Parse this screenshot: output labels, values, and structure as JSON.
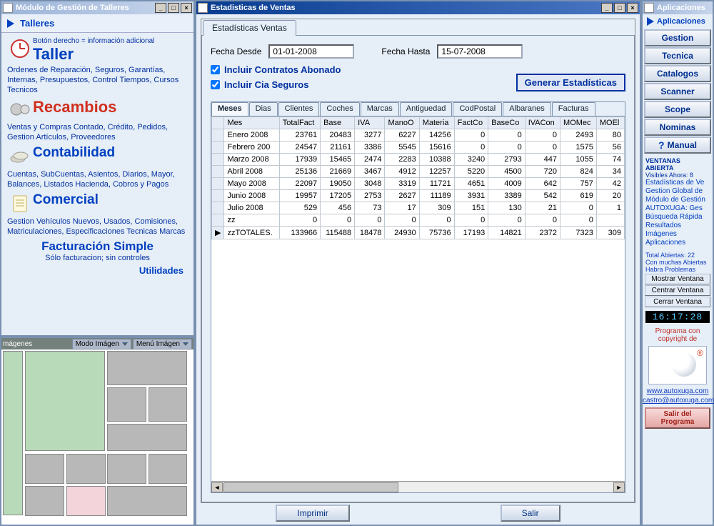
{
  "left": {
    "title": "Módulo de Gestión de Talleres",
    "header": "Talleres",
    "note": "Botón derecho = información adicional",
    "taller": {
      "title": "Taller",
      "desc": "Ordenes de Reparación, Seguros, Garantías, Internas, Presupuestos, Control Tiempos, Cursos Tecnicos"
    },
    "recambios": {
      "title": "Recambios",
      "desc": "Ventas y Compras Contado, Crédito, Pedidos, Gestion Artículos, Proveedores"
    },
    "contabilidad": {
      "title": "Contabilidad",
      "desc": "Cuentas, SubCuentas, Asientos, Diarios, Mayor, Balances, Listados Hacienda, Cobros y Pagos"
    },
    "comercial": {
      "title": "Comercial",
      "desc": "Gestion Vehículos Nuevos, Usados, Comisiones, Matriculaciones, Especificaciones Tecnicas Marcas"
    },
    "factsimple": {
      "title": "Facturación Simple",
      "desc": "Sólo facturacion; sin controles"
    },
    "utilidades": "Utilidades",
    "images": {
      "title": "mágenes",
      "modo": "Modo Imágen",
      "menu": "Menú Imágen"
    }
  },
  "mid": {
    "title": "Estadisticas de Ventas",
    "tab": "Estadísticas Ventas",
    "desde_label": "Fecha Desde",
    "desde_value": "01-01-2008",
    "hasta_label": "Fecha Hasta",
    "hasta_value": "15-07-2008",
    "chk1": "Incluir Contratos Abonado",
    "chk2": "Incluir Cia Seguros",
    "gen_btn": "Generar Estadísticas",
    "grid_tabs": [
      "Meses",
      "Dias",
      "Clientes",
      "Coches",
      "Marcas",
      "Antiguedad",
      "CodPostal",
      "Albaranes",
      "Facturas"
    ],
    "columns": [
      "Mes",
      "TotalFact",
      "Base",
      "IVA",
      "ManoO",
      "Materia",
      "FactCo",
      "BaseCo",
      "IVACon",
      "MOMec",
      "MOEl"
    ],
    "rows": [
      [
        "Enero 2008",
        "23761",
        "20483",
        "3277",
        "6227",
        "14256",
        "0",
        "0",
        "0",
        "2493",
        "80"
      ],
      [
        "Febrero 200",
        "24547",
        "21161",
        "3386",
        "5545",
        "15616",
        "0",
        "0",
        "0",
        "1575",
        "56"
      ],
      [
        "Marzo 2008",
        "17939",
        "15465",
        "2474",
        "2283",
        "10388",
        "3240",
        "2793",
        "447",
        "1055",
        "74"
      ],
      [
        "Abril 2008",
        "25136",
        "21669",
        "3467",
        "4912",
        "12257",
        "5220",
        "4500",
        "720",
        "824",
        "34"
      ],
      [
        "Mayo 2008",
        "22097",
        "19050",
        "3048",
        "3319",
        "11721",
        "4651",
        "4009",
        "642",
        "757",
        "42"
      ],
      [
        "Junio 2008",
        "19957",
        "17205",
        "2753",
        "2627",
        "11189",
        "3931",
        "3389",
        "542",
        "619",
        "20"
      ],
      [
        "Julio 2008",
        "529",
        "456",
        "73",
        "17",
        "309",
        "151",
        "130",
        "21",
        "0",
        "1"
      ],
      [
        "zz",
        "0",
        "0",
        "0",
        "0",
        "0",
        "0",
        "0",
        "0",
        "0",
        ""
      ],
      [
        "zzTOTALES.",
        "133966",
        "115488",
        "18478",
        "24930",
        "75736",
        "17193",
        "14821",
        "2372",
        "7323",
        "309"
      ]
    ],
    "print": "Imprimir",
    "exit": "Salir"
  },
  "right": {
    "title": "Aplicaciones",
    "header": "Aplicaciones",
    "apps": [
      "Gestion",
      "Tecnica",
      "Catalogos",
      "Scanner",
      "Scope",
      "Nominas",
      "Manual"
    ],
    "ventanas_hdr": "VENTANAS ABIERTA",
    "visibles": "Visibles Ahora: 8",
    "winlist": [
      "Estadísticas de Ve",
      "Gestion Global de",
      "Módulo de Gestión",
      "AUTOXUGA: Ges",
      "Búsqueda Rápida",
      "Resultados",
      "Imágenes",
      "Aplicaciones"
    ],
    "total": "Total Abiertas: 22",
    "warn": "Con muchas Abiertas Habra Problemas",
    "btns": [
      "Mostrar Ventana",
      "Centrar Ventana",
      "Cerrar Ventana"
    ],
    "clock": "16:17:28",
    "copy": "Programa con copyright de",
    "link1": "www.autoxuga.com",
    "link2": "castro@autoxuga.com",
    "exit": "Salir del Programa"
  }
}
